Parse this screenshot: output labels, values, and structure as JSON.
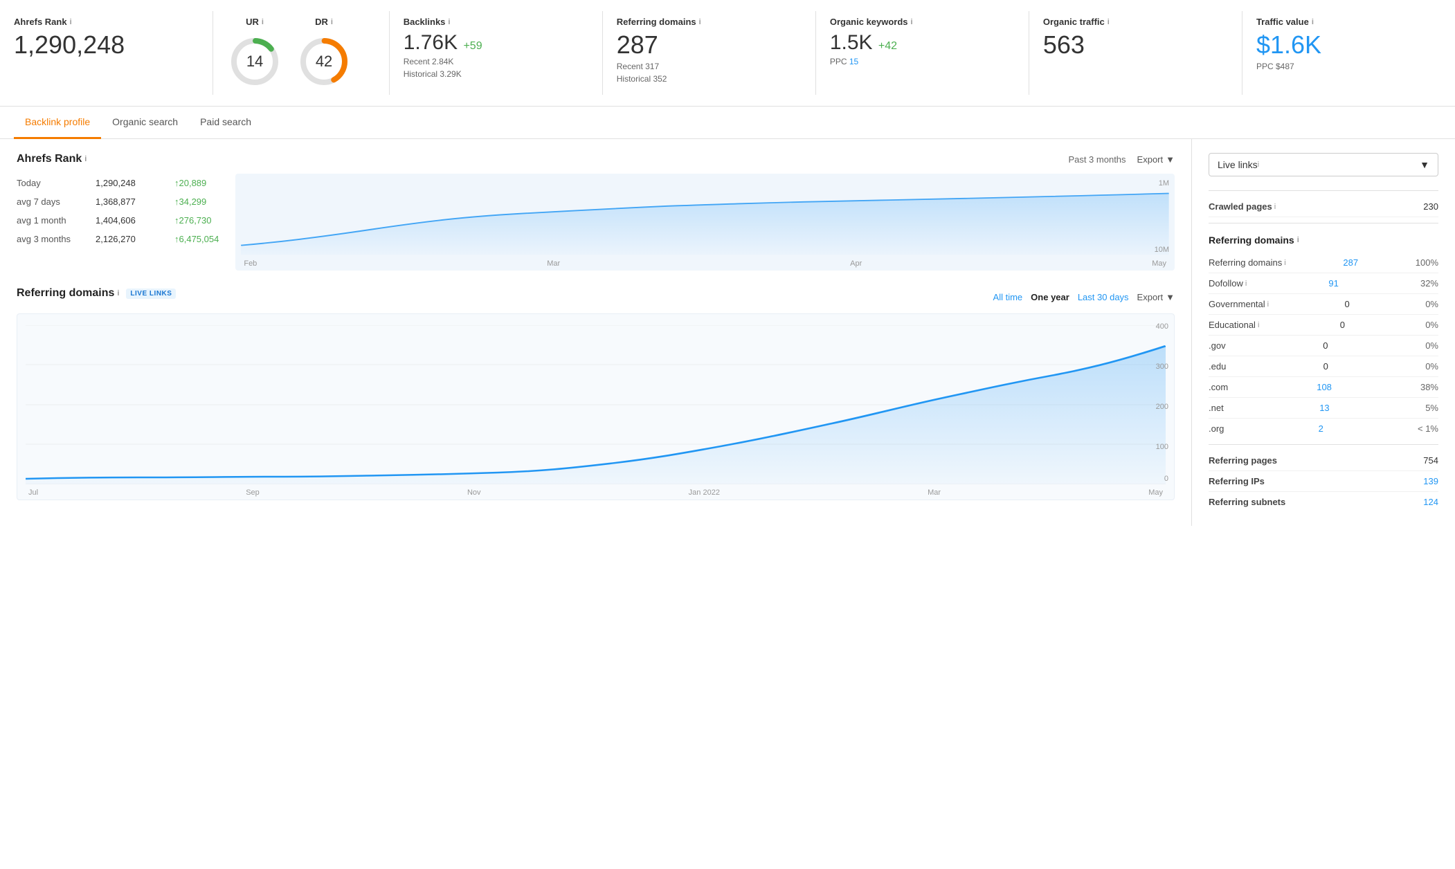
{
  "metrics": {
    "ahrefs_rank": {
      "label": "Ahrefs Rank",
      "value": "1,290,248"
    },
    "ur": {
      "label": "UR",
      "value": "14",
      "color_arc": "#4caf50",
      "percentage": 14
    },
    "dr": {
      "label": "DR",
      "value": "42",
      "color_arc": "#f57c00",
      "percentage": 42
    },
    "backlinks": {
      "label": "Backlinks",
      "value": "1.76K",
      "plus": "+59",
      "recent": "Recent 2.84K",
      "historical": "Historical 3.29K"
    },
    "referring_domains": {
      "label": "Referring domains",
      "value": "287",
      "recent": "Recent 317",
      "historical": "Historical 352"
    },
    "organic_keywords": {
      "label": "Organic keywords",
      "value": "1.5K",
      "plus": "+42",
      "ppc_label": "PPC",
      "ppc_value": "15"
    },
    "organic_traffic": {
      "label": "Organic traffic",
      "value": "563"
    },
    "traffic_value": {
      "label": "Traffic value",
      "value": "$1.6K",
      "ppc_label": "PPC",
      "ppc_value": "$487"
    }
  },
  "tabs": [
    {
      "id": "backlink",
      "label": "Backlink profile",
      "active": true
    },
    {
      "id": "organic",
      "label": "Organic search",
      "active": false
    },
    {
      "id": "paid",
      "label": "Paid search",
      "active": false
    }
  ],
  "ahrefs_rank_section": {
    "title": "Ahrefs Rank",
    "period_label": "Past 3 months",
    "export_label": "Export",
    "rows": [
      {
        "label": "Today",
        "value": "1,290,248",
        "change": "↑20,889"
      },
      {
        "label": "avg 7 days",
        "value": "1,368,877",
        "change": "↑34,299"
      },
      {
        "label": "avg 1 month",
        "value": "1,404,606",
        "change": "↑276,730"
      },
      {
        "label": "avg 3 months",
        "value": "2,126,270",
        "change": "↑6,475,054"
      }
    ],
    "chart_labels": [
      "Feb",
      "Mar",
      "Apr",
      "May"
    ],
    "chart_y_max": "1M",
    "chart_y_mid": "10M"
  },
  "referring_domains_section": {
    "title": "Referring domains",
    "live_links": "LIVE LINKS",
    "all_time": "All time",
    "one_year": "One year",
    "last_30": "Last 30 days",
    "export_label": "Export",
    "chart_x_labels": [
      "Jul",
      "Sep",
      "Nov",
      "Jan 2022",
      "Mar",
      "May"
    ],
    "chart_y_labels": [
      "400",
      "300",
      "200",
      "100",
      "0"
    ]
  },
  "right_panel": {
    "dropdown_label": "Live links",
    "sections": [
      {
        "title": "Crawled pages",
        "value": "230",
        "value_color": "black",
        "is_single": true
      }
    ],
    "referring_domains": {
      "title": "Referring domains",
      "rows": [
        {
          "label": "Referring domains",
          "value": "287",
          "pct": "100%",
          "value_color": "blue"
        },
        {
          "label": "Dofollow",
          "value": "91",
          "pct": "32%",
          "value_color": "blue"
        },
        {
          "label": "Governmental",
          "value": "0",
          "pct": "0%",
          "value_color": "black"
        },
        {
          "label": "Educational",
          "value": "0",
          "pct": "0%",
          "value_color": "black"
        },
        {
          "label": ".gov",
          "value": "0",
          "pct": "0%",
          "value_color": "black"
        },
        {
          "label": ".edu",
          "value": "0",
          "pct": "0%",
          "value_color": "black"
        },
        {
          "label": ".com",
          "value": "108",
          "pct": "38%",
          "value_color": "blue"
        },
        {
          "label": ".net",
          "value": "13",
          "pct": "5%",
          "value_color": "blue"
        },
        {
          "label": ".org",
          "value": "2",
          "pct": "< 1%",
          "value_color": "blue"
        }
      ]
    },
    "bottom_rows": [
      {
        "label": "Referring pages",
        "value": "754",
        "value_color": "black"
      },
      {
        "label": "Referring IPs",
        "value": "139",
        "value_color": "blue"
      },
      {
        "label": "Referring subnets",
        "value": "124",
        "value_color": "blue"
      }
    ]
  },
  "info_icon": "i",
  "chevron_down": "▼",
  "up_arrow": "↑"
}
